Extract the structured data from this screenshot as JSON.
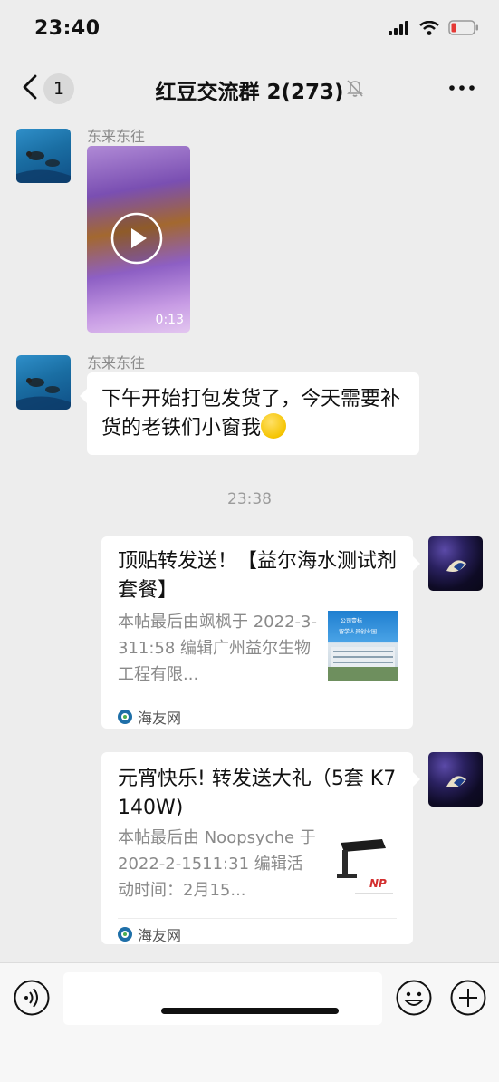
{
  "status": {
    "time": "23:40"
  },
  "nav": {
    "unread_count": "1",
    "title": "红豆交流群 2(273)"
  },
  "messages": {
    "m1": {
      "sender": "东来东往",
      "video_duration": "0:13"
    },
    "m2": {
      "sender": "东来东往",
      "text": "下午开始打包发货了，今天需要补货的老铁们小窗我"
    },
    "timestamp": "23:38",
    "card1": {
      "title": "顶贴转发送！【益尔海水测试剂套餐】",
      "desc": "本帖最后由飒枫于 2022-3-311:58 编辑广州益尔生物工程有限...",
      "thumb_text_1": "公司壹标",
      "thumb_text_2": "留学人员创业园",
      "source": "海友网"
    },
    "card2": {
      "title": "元宵快乐! 转发送大礼（5套 K7  140W)",
      "desc": "本帖最后由 Noopsyche 于 2022-2-1511:31 编辑活动时间：2月15...",
      "thumb_logo": "NP",
      "source": "海友网"
    }
  },
  "icons": {
    "back": "chevron-left-icon",
    "mute": "bell-off-icon",
    "more": "more-dots-icon",
    "voice": "voice-icon",
    "emoji": "emoji-icon",
    "plus": "plus-icon",
    "play": "play-icon"
  },
  "colors": {
    "background": "#ededed",
    "bubble": "#ffffff",
    "input_bar": "#f7f7f7"
  }
}
